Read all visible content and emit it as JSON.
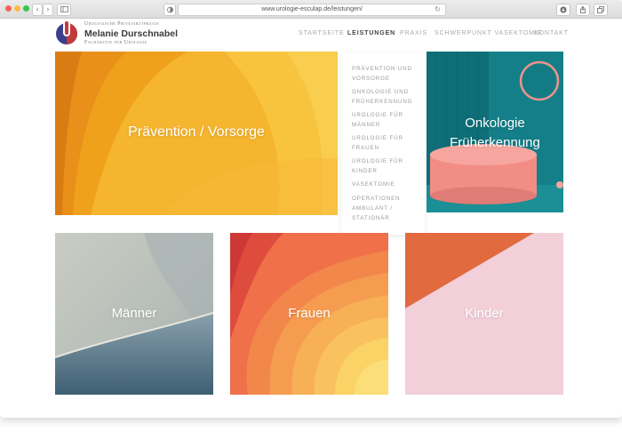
{
  "browser": {
    "url": "www.urologie-esculap.de/leistungen/",
    "back_icon": "chevron-left-icon",
    "forward_icon": "chevron-right-icon",
    "reload_icon": "reload-icon"
  },
  "brand": {
    "small_title": "Urologische Privatarztpraxis",
    "name": "Melanie Durschnabel",
    "subtitle": "Fachärztin für Urologie",
    "colors": {
      "blue": "#3a3f8c",
      "red": "#c23a3a"
    }
  },
  "nav": {
    "items": [
      {
        "label": "STARTSEITE",
        "active": false
      },
      {
        "label": "LEISTUNGEN",
        "active": true
      },
      {
        "label": "PRAXIS",
        "active": false
      },
      {
        "label": "SCHWERPUNKT VASEKTOMIE",
        "active": false
      },
      {
        "label": "KONTAKT",
        "active": false
      }
    ]
  },
  "dropdown": {
    "items": [
      {
        "line1": "PRÄVENTION UND",
        "line2": "VORSORGE"
      },
      {
        "line1": "ONKOLOGIE UND",
        "line2": "FRÜHERKENNUNG"
      },
      {
        "line1": "UROLOGIE FÜR",
        "line2": "MÄNNER"
      },
      {
        "line1": "UROLOGIE FÜR",
        "line2": "FRAUEN"
      },
      {
        "line1": "UROLOGIE FÜR",
        "line2": "KINDER"
      },
      {
        "line1": "VASEKTOMIE",
        "line2": ""
      },
      {
        "line1": "OPERATIONEN",
        "line2": "AMBULANT /"
      },
      {
        "line1": "STATIONÄR",
        "line2": ""
      }
    ]
  },
  "tiles": {
    "praevention": "Prävention / Vorsorge",
    "onkologie_line1": "Onkologie",
    "onkologie_line2": "Früherkennung",
    "maenner": "Männer",
    "frauen": "Frauen",
    "kinder": "Kinder"
  }
}
